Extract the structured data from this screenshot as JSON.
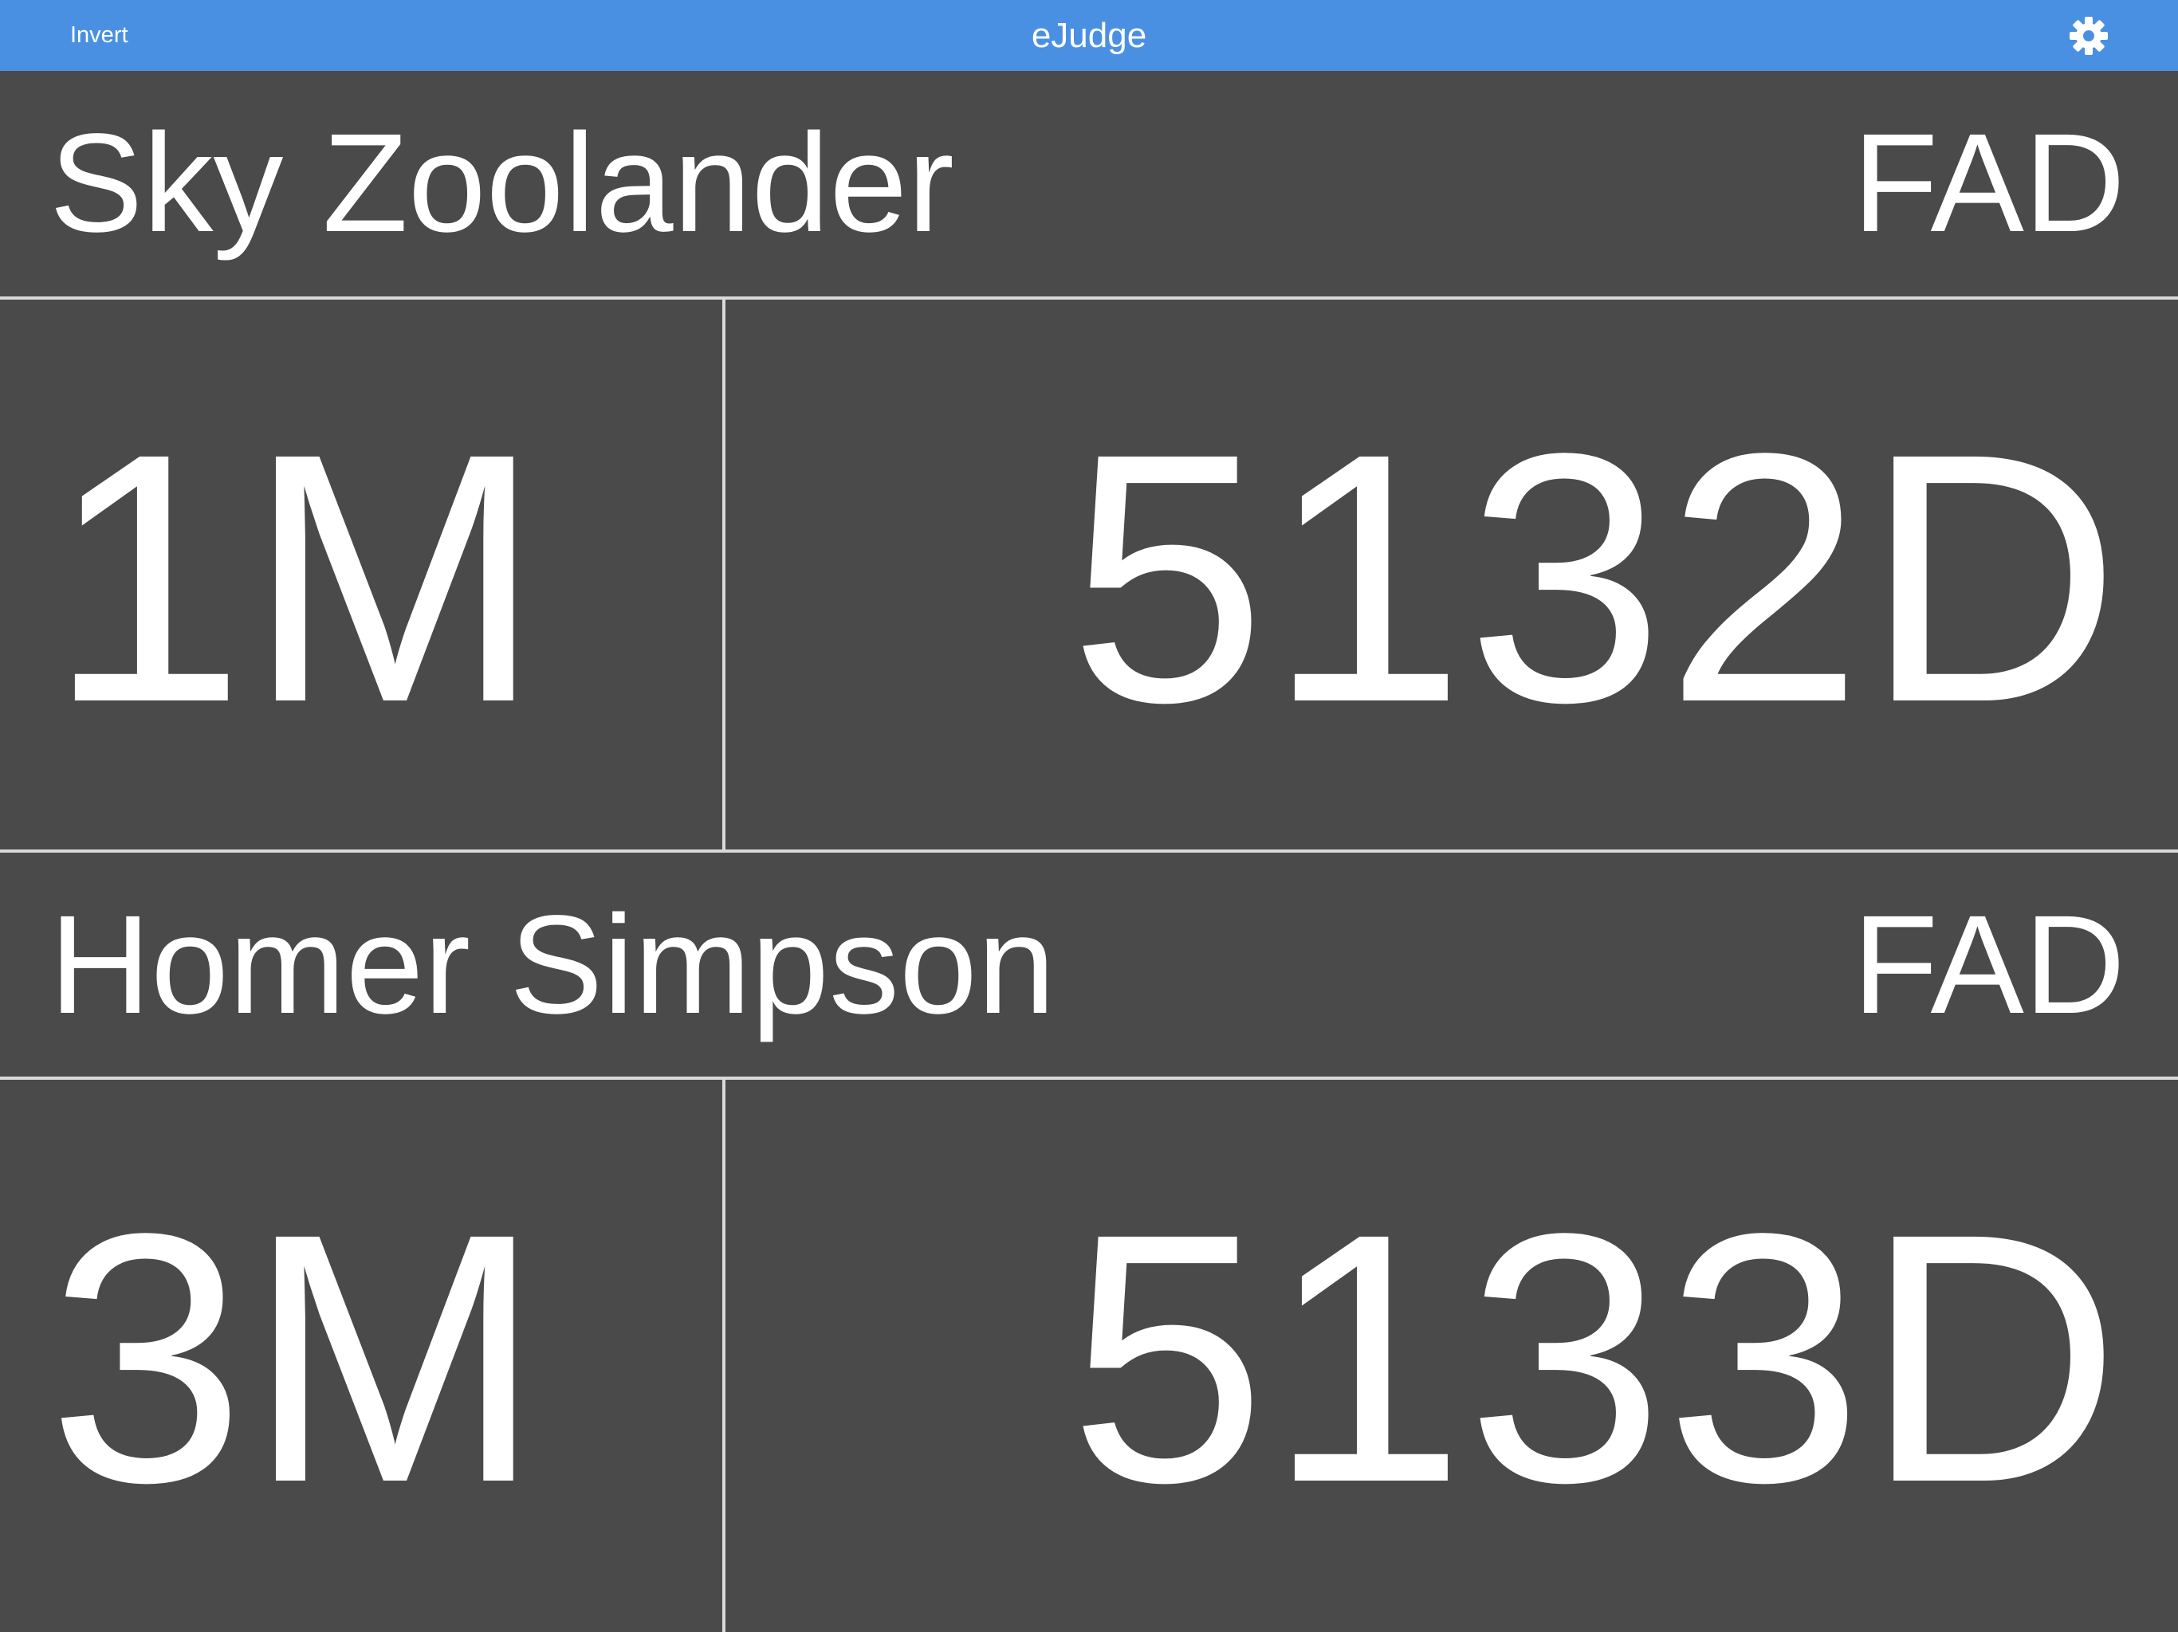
{
  "navbar": {
    "left_button": "Invert",
    "title": "eJudge",
    "settings_icon": "gear-icon",
    "background": "#4a90e2"
  },
  "colors": {
    "background": "#4a4a4a",
    "divider": "#d9d9d9",
    "text": "#ffffff"
  },
  "divers": [
    {
      "name": "Sky Zoolander",
      "event": "FAD",
      "board": "1M",
      "dive": "5132D"
    },
    {
      "name": "Homer Simpson",
      "event": "FAD",
      "board": "3M",
      "dive": "5133D"
    }
  ]
}
